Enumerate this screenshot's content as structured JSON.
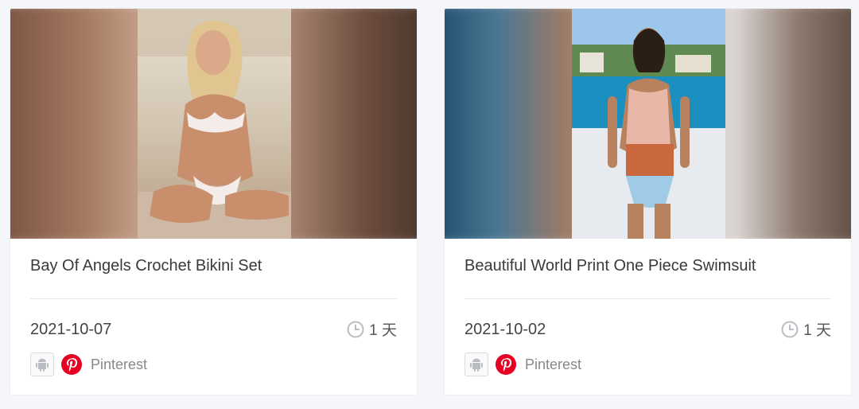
{
  "colors": {
    "page_bg": "#f4f6f9",
    "card_bg": "#ffffff",
    "pinterest_red": "#e60023",
    "icon_gray": "#b9bdc3"
  },
  "cards": [
    {
      "title": "Bay Of Angels Crochet Bikini Set",
      "date": "2021-10-07",
      "duration": "1 天",
      "platform_os_icon": "android-icon",
      "platform_icon": "pinterest-icon",
      "platform_label": "Pinterest"
    },
    {
      "title": "Beautiful World Print One Piece Swimsuit",
      "date": "2021-10-02",
      "duration": "1 天",
      "platform_os_icon": "android-icon",
      "platform_icon": "pinterest-icon",
      "platform_label": "Pinterest"
    }
  ]
}
